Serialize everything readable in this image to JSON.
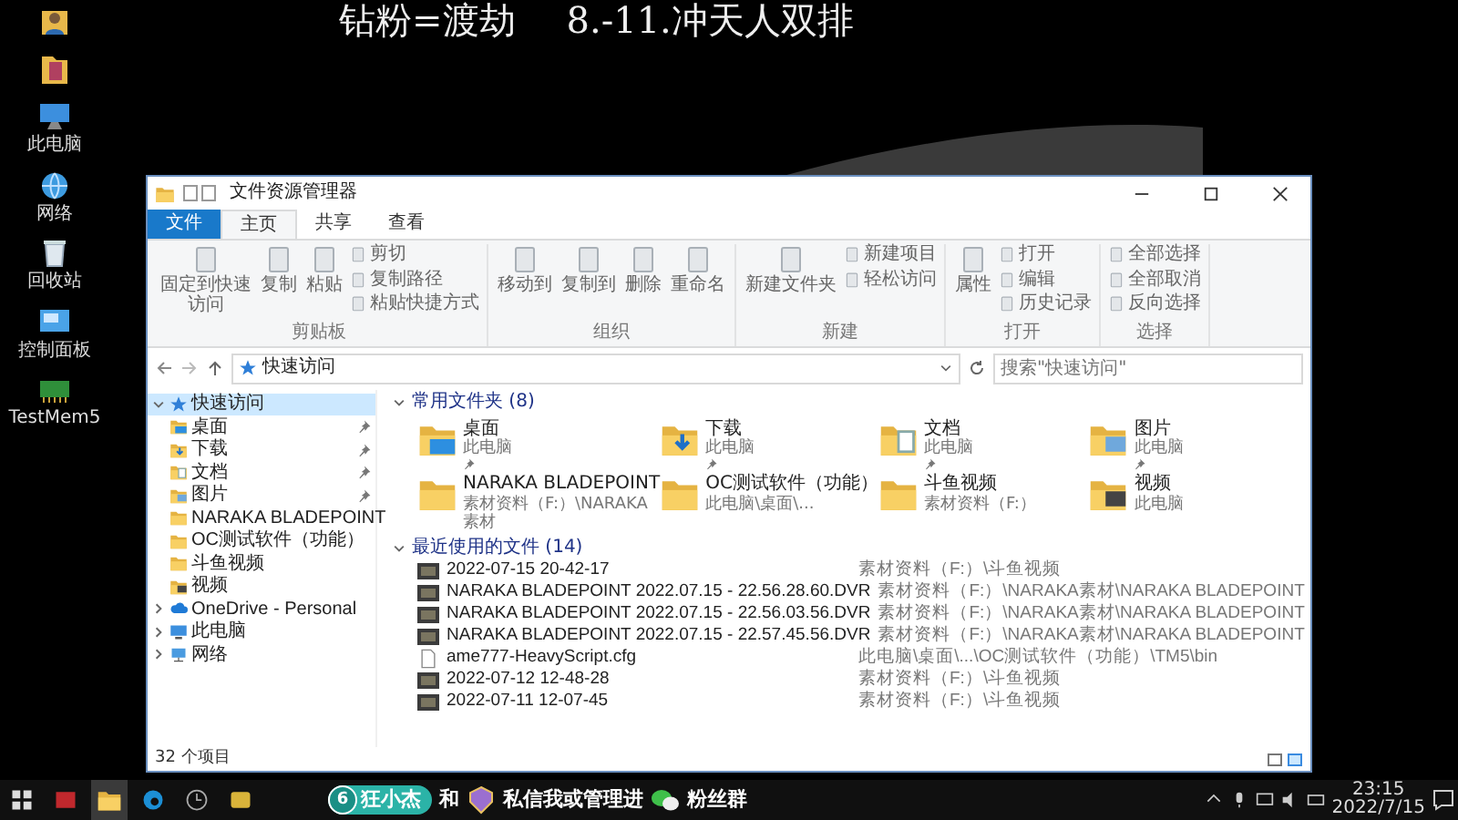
{
  "headline": {
    "left": "钻粉=渡劫",
    "right": "8.-11.冲天人双排"
  },
  "desktop_icons": [
    {
      "kind": "user"
    },
    {
      "kind": "file"
    },
    {
      "kind": "pc",
      "label": "此电脑"
    },
    {
      "kind": "network",
      "label": "网络"
    },
    {
      "kind": "bin",
      "label": "回收站"
    },
    {
      "kind": "panel",
      "label": "控制面板"
    },
    {
      "kind": "app",
      "label": "TestMem5"
    }
  ],
  "window": {
    "title": "文件资源管理器",
    "tabs": [
      {
        "label": "文件",
        "kind": "file",
        "selected": false
      },
      {
        "label": "主页",
        "kind": "tab",
        "selected": true
      },
      {
        "label": "共享",
        "kind": "tab",
        "selected": false
      },
      {
        "label": "查看",
        "kind": "tab",
        "selected": false
      }
    ],
    "ribbon": [
      {
        "label": "剪贴板",
        "buttons": [
          {
            "label": "固定到快速访问",
            "kind": "large"
          },
          {
            "label": "复制",
            "kind": "large"
          },
          {
            "label": "粘贴",
            "kind": "large"
          },
          {
            "label": "剪切",
            "kind": "small"
          },
          {
            "label": "复制路径",
            "kind": "small"
          },
          {
            "label": "粘贴快捷方式",
            "kind": "small"
          }
        ]
      },
      {
        "label": "组织",
        "buttons": [
          {
            "label": "移动到",
            "kind": "large"
          },
          {
            "label": "复制到",
            "kind": "large"
          },
          {
            "label": "删除",
            "kind": "large"
          },
          {
            "label": "重命名",
            "kind": "large"
          }
        ]
      },
      {
        "label": "新建",
        "buttons": [
          {
            "label": "新建文件夹",
            "kind": "large"
          },
          {
            "label": "新建项目",
            "kind": "small"
          },
          {
            "label": "轻松访问",
            "kind": "small"
          }
        ]
      },
      {
        "label": "打开",
        "buttons": [
          {
            "label": "属性",
            "kind": "large"
          },
          {
            "label": "打开",
            "kind": "small"
          },
          {
            "label": "编辑",
            "kind": "small"
          },
          {
            "label": "历史记录",
            "kind": "small"
          }
        ]
      },
      {
        "label": "选择",
        "buttons": [
          {
            "label": "全部选择",
            "kind": "small"
          },
          {
            "label": "全部取消",
            "kind": "small"
          },
          {
            "label": "反向选择",
            "kind": "small"
          }
        ]
      }
    ],
    "address": {
      "path": "快速访问",
      "search_placeholder": "搜索\"快速访问\""
    },
    "nav": [
      {
        "label": "快速访问",
        "kind": "quick",
        "selected": true,
        "expanded": true,
        "children": [
          {
            "label": "桌面",
            "kind": "desktop",
            "pinned": true
          },
          {
            "label": "下载",
            "kind": "download",
            "pinned": true
          },
          {
            "label": "文档",
            "kind": "doc",
            "pinned": true
          },
          {
            "label": "图片",
            "kind": "pic",
            "pinned": true
          },
          {
            "label": "NARAKA  BLADEPOINT",
            "kind": "folder",
            "pinned": false
          },
          {
            "label": "OC测试软件（功能）",
            "kind": "folder",
            "pinned": false
          },
          {
            "label": "斗鱼视频",
            "kind": "folder",
            "pinned": false
          },
          {
            "label": "视频",
            "kind": "video",
            "pinned": false
          }
        ]
      },
      {
        "label": "OneDrive - Personal",
        "kind": "cloud",
        "selected": false,
        "expanded": false
      },
      {
        "label": "此电脑",
        "kind": "pc",
        "selected": false,
        "expanded": false
      },
      {
        "label": "网络",
        "kind": "network",
        "selected": false,
        "expanded": false
      }
    ],
    "frequent": {
      "title": "常用文件夹 (8)",
      "expanded": true,
      "items": [
        {
          "name": "桌面",
          "location": "此电脑",
          "pinned": true
        },
        {
          "name": "下载",
          "location": "此电脑",
          "pinned": true
        },
        {
          "name": "文档",
          "location": "此电脑",
          "pinned": true
        },
        {
          "name": "图片",
          "location": "此电脑",
          "pinned": true
        },
        {
          "name": "NARAKA  BLADEPOINT",
          "location": "素材资料（F:）\\NARAKA素材",
          "pinned": false
        },
        {
          "name": "OC测试软件（功能）",
          "location": "此电脑\\桌面\\...",
          "pinned": false
        },
        {
          "name": "斗鱼视频",
          "location": "素材资料（F:）",
          "pinned": false
        },
        {
          "name": "视频",
          "location": "此电脑",
          "pinned": false
        }
      ]
    },
    "recent": {
      "title": "最近使用的文件 (14)",
      "expanded": true,
      "items": [
        {
          "name": "2022-07-15 20-42-17",
          "path": "素材资料（F:）\\斗鱼视频",
          "kind": "video"
        },
        {
          "name": "NARAKA  BLADEPOINT 2022.07.15 - 22.56.28.60.DVR",
          "path": "素材资料（F:）\\NARAKA素材\\NARAKA  BLADEPOINT",
          "kind": "video"
        },
        {
          "name": "NARAKA  BLADEPOINT 2022.07.15 - 22.56.03.56.DVR",
          "path": "素材资料（F:）\\NARAKA素材\\NARAKA  BLADEPOINT",
          "kind": "video"
        },
        {
          "name": "NARAKA  BLADEPOINT 2022.07.15 - 22.57.45.56.DVR",
          "path": "素材资料（F:）\\NARAKA素材\\NARAKA  BLADEPOINT",
          "kind": "video"
        },
        {
          "name": "ame777-HeavyScript.cfg",
          "path": "此电脑\\桌面\\...\\OC测试软件（功能）\\TM5\\bin",
          "kind": "file"
        },
        {
          "name": "2022-07-12 12-48-28",
          "path": "素材资料（F:）\\斗鱼视频",
          "kind": "video"
        },
        {
          "name": "2022-07-11 12-07-45",
          "path": "素材资料（F:）\\斗鱼视频",
          "kind": "video"
        }
      ]
    },
    "status": "32 个项目"
  },
  "taskbar": {
    "banner": {
      "level": "6",
      "user": "狂小杰",
      "and": "和",
      "message": "私信我或管理进",
      "group": "粉丝群"
    },
    "time": "23:15",
    "date": "2022/7/15"
  }
}
